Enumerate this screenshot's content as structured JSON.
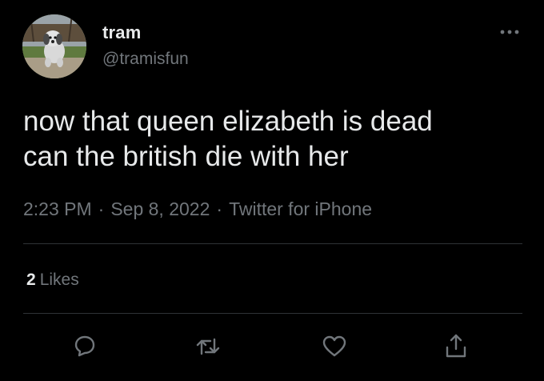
{
  "tweet": {
    "display_name": "tram",
    "handle": "@tramisfun",
    "text": "now that queen elizabeth is dead\ncan the british die with her",
    "time": "2:23 PM",
    "date": "Sep 8, 2022",
    "source": "Twitter for iPhone",
    "separator": "·",
    "likes_count": "2",
    "likes_label": "Likes"
  },
  "icons": {
    "more": "more-horizontal-icon",
    "reply": "reply-icon",
    "retweet": "retweet-icon",
    "like": "heart-icon",
    "share": "share-icon"
  },
  "colors": {
    "background": "#000000",
    "primary_text": "#e7e9ea",
    "secondary_text": "#71767b",
    "divider": "#2f3336"
  }
}
